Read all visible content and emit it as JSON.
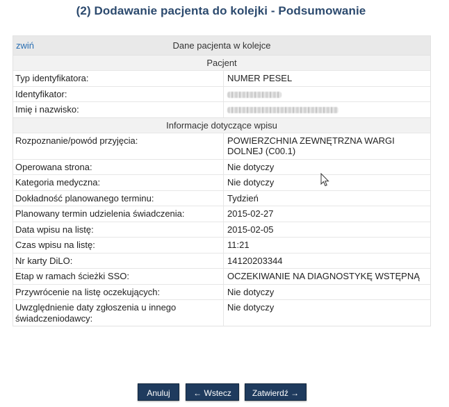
{
  "page": {
    "title": "(2) Dodawanie pacjenta do kolejki - Podsumowanie"
  },
  "panel": {
    "collapse_label": "zwiń",
    "header_title": "Dane pacjenta w kolejce"
  },
  "sections": {
    "patient": {
      "title": "Pacjent",
      "rows": [
        {
          "label": "Typ identyfikatora:",
          "value": "NUMER PESEL"
        },
        {
          "label": "Identyfikator:",
          "value": ""
        },
        {
          "label": "Imię i nazwisko:",
          "value": ""
        }
      ]
    },
    "entry": {
      "title": "Informacje dotyczące wpisu",
      "rows": [
        {
          "label": "Rozpoznanie/powód przyjęcia:",
          "value": "POWIERZCHNIA ZEWNĘTRZNA WARGI DOLNEJ (C00.1)"
        },
        {
          "label": "Operowana strona:",
          "value": "Nie dotyczy"
        },
        {
          "label": "Kategoria medyczna:",
          "value": "Nie dotyczy"
        },
        {
          "label": "Dokładność planowanego terminu:",
          "value": "Tydzień"
        },
        {
          "label": "Planowany termin udzielenia świadczenia:",
          "value": "2015-02-27"
        },
        {
          "label": "Data wpisu na listę:",
          "value": "2015-02-05"
        },
        {
          "label": "Czas wpisu na listę:",
          "value": "11:21"
        },
        {
          "label": "Nr karty DiLO:",
          "value": "14120203344"
        },
        {
          "label": "Etap w ramach ścieżki SSO:",
          "value": "OCZEKIWANIE NA DIAGNOSTYKĘ WSTĘPNĄ"
        },
        {
          "label": "Przywrócenie na listę oczekujących:",
          "value": "Nie dotyczy"
        },
        {
          "label": "Uwzględnienie daty zgłoszenia u innego świadczeniodawcy:",
          "value": "Nie dotyczy"
        }
      ]
    }
  },
  "buttons": {
    "cancel": "Anuluj",
    "back": "← Wstecz",
    "confirm": "Zatwierdź →"
  },
  "colors": {
    "title": "#2c4a6e",
    "link": "#2a6fb3",
    "button_bg": "#1f3b5e",
    "header_bg": "#e9e9e9"
  }
}
